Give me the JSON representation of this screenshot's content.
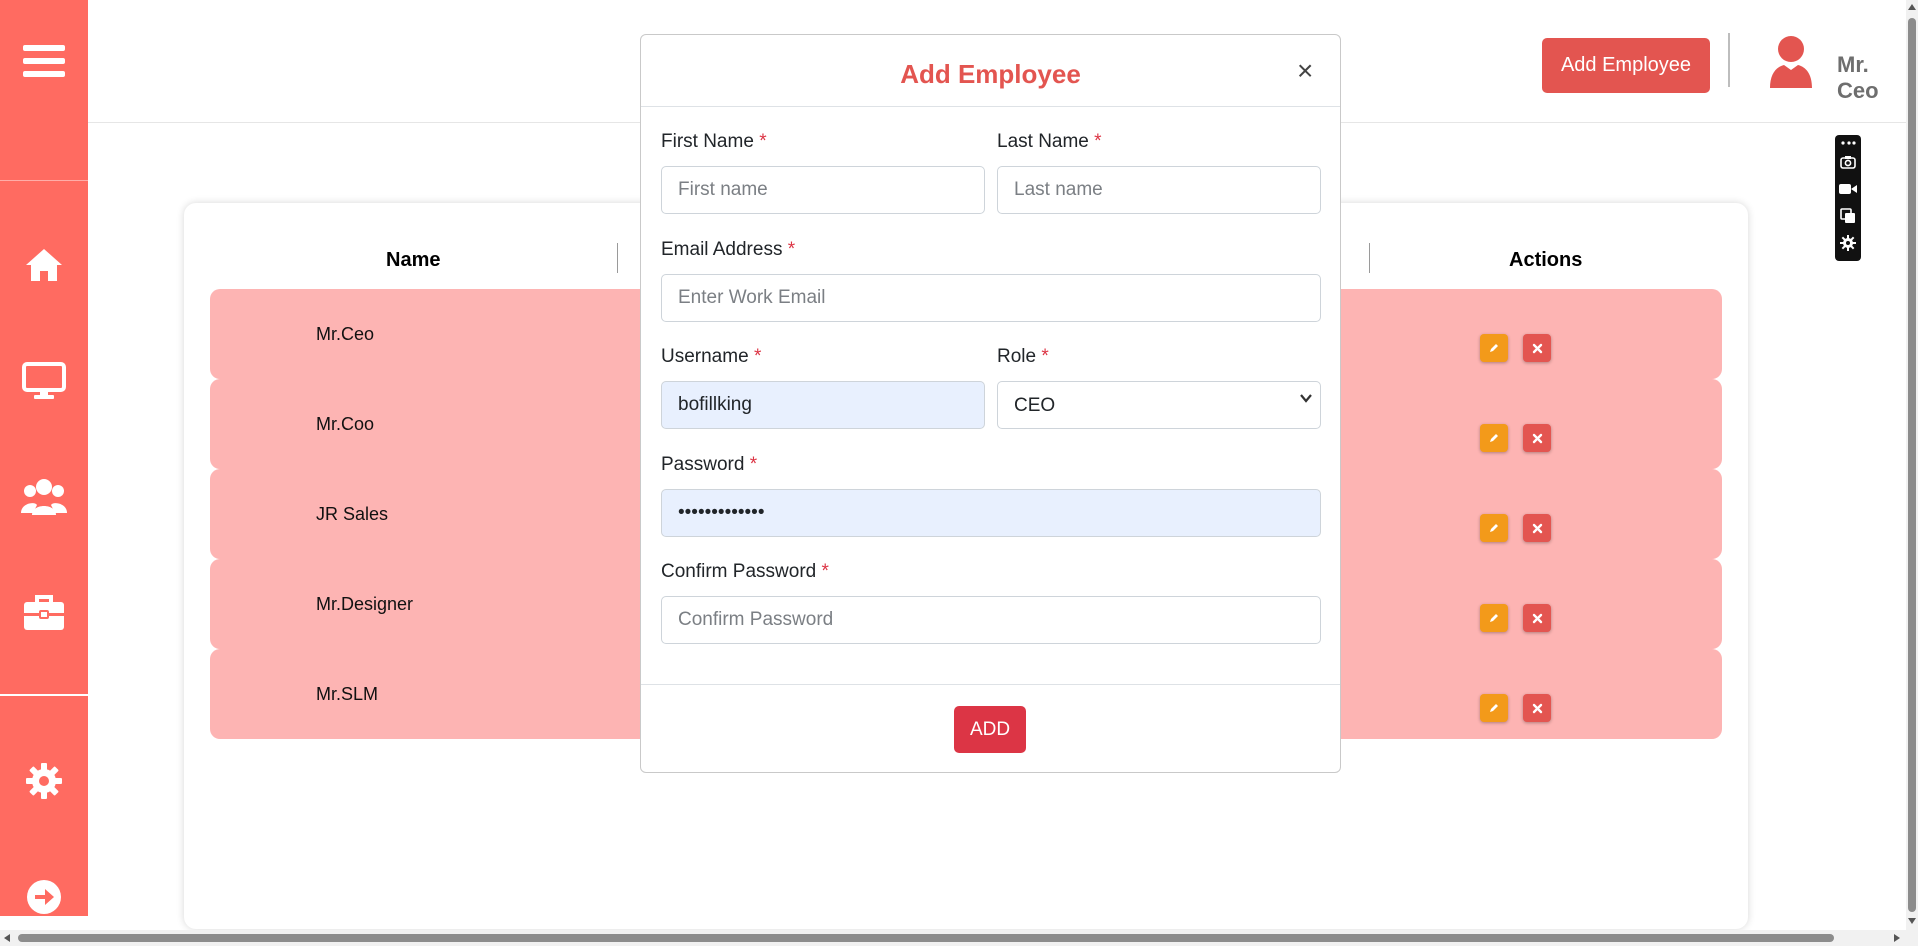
{
  "header": {
    "add_employee_label": "Add Employee",
    "user_name": "Mr. Ceo"
  },
  "table": {
    "columns": [
      "Name",
      "Actions"
    ],
    "rows": [
      {
        "name": "Mr.Ceo"
      },
      {
        "name": "Mr.Coo"
      },
      {
        "name": "JR Sales"
      },
      {
        "name": "Mr.Designer"
      },
      {
        "name": "Mr.SLM"
      }
    ]
  },
  "modal": {
    "title": "Add Employee",
    "close_glyph": "×",
    "required_mark": "*",
    "first_name": {
      "label": "First Name",
      "placeholder": "First name",
      "value": ""
    },
    "last_name": {
      "label": "Last Name",
      "placeholder": "Last name",
      "value": ""
    },
    "email": {
      "label": "Email Address",
      "placeholder": "Enter Work Email",
      "value": ""
    },
    "username": {
      "label": "Username",
      "value": "bofillking"
    },
    "role": {
      "label": "Role",
      "selected": "CEO"
    },
    "password": {
      "label": "Password",
      "value": "•••••••••••••"
    },
    "confirm_password": {
      "label": "Confirm Password",
      "placeholder": "Confirm Password",
      "value": ""
    },
    "submit_label": "ADD"
  },
  "sidebar": {
    "items": [
      {
        "icon": "menu-icon"
      },
      {
        "icon": "home-icon"
      },
      {
        "icon": "monitor-icon"
      },
      {
        "icon": "users-icon"
      },
      {
        "icon": "briefcase-icon"
      },
      {
        "icon": "gear-icon"
      },
      {
        "icon": "logout-icon"
      }
    ]
  },
  "colors": {
    "sidebar": "#ff6b61",
    "accent": "#e35550",
    "row_bg": "#fdb4b3",
    "edit": "#f39a1a",
    "submit": "#dc3545"
  }
}
